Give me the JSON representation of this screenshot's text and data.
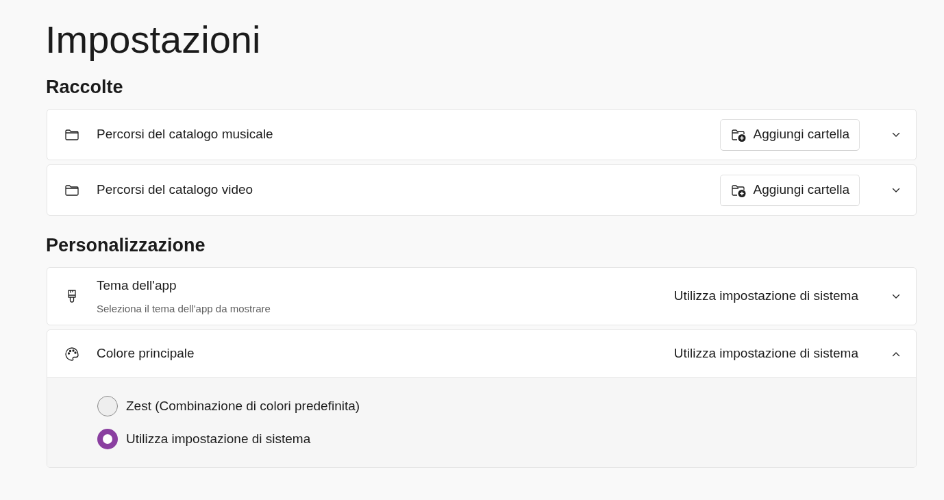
{
  "title": "Impostazioni",
  "sections": [
    {
      "heading": "Raccolte",
      "items": [
        {
          "kind": "folder",
          "label": "Percorsi del catalogo musicale",
          "button": "Aggiungi cartella",
          "expanded": false
        },
        {
          "kind": "folder",
          "label": "Percorsi del catalogo video",
          "button": "Aggiungi cartella",
          "expanded": false
        }
      ]
    },
    {
      "heading": "Personalizzazione",
      "items": [
        {
          "kind": "theme",
          "label": "Tema dell'app",
          "description": "Seleziona il tema dell'app da mostrare",
          "value": "Utilizza impostazione di sistema",
          "expanded": false
        },
        {
          "kind": "color",
          "label": "Colore principale",
          "value": "Utilizza impostazione di sistema",
          "expanded": true,
          "options": [
            {
              "label": "Zest (Combinazione di colori predefinita)",
              "selected": false
            },
            {
              "label": "Utilizza impostazione di sistema",
              "selected": true
            }
          ]
        }
      ]
    }
  ]
}
